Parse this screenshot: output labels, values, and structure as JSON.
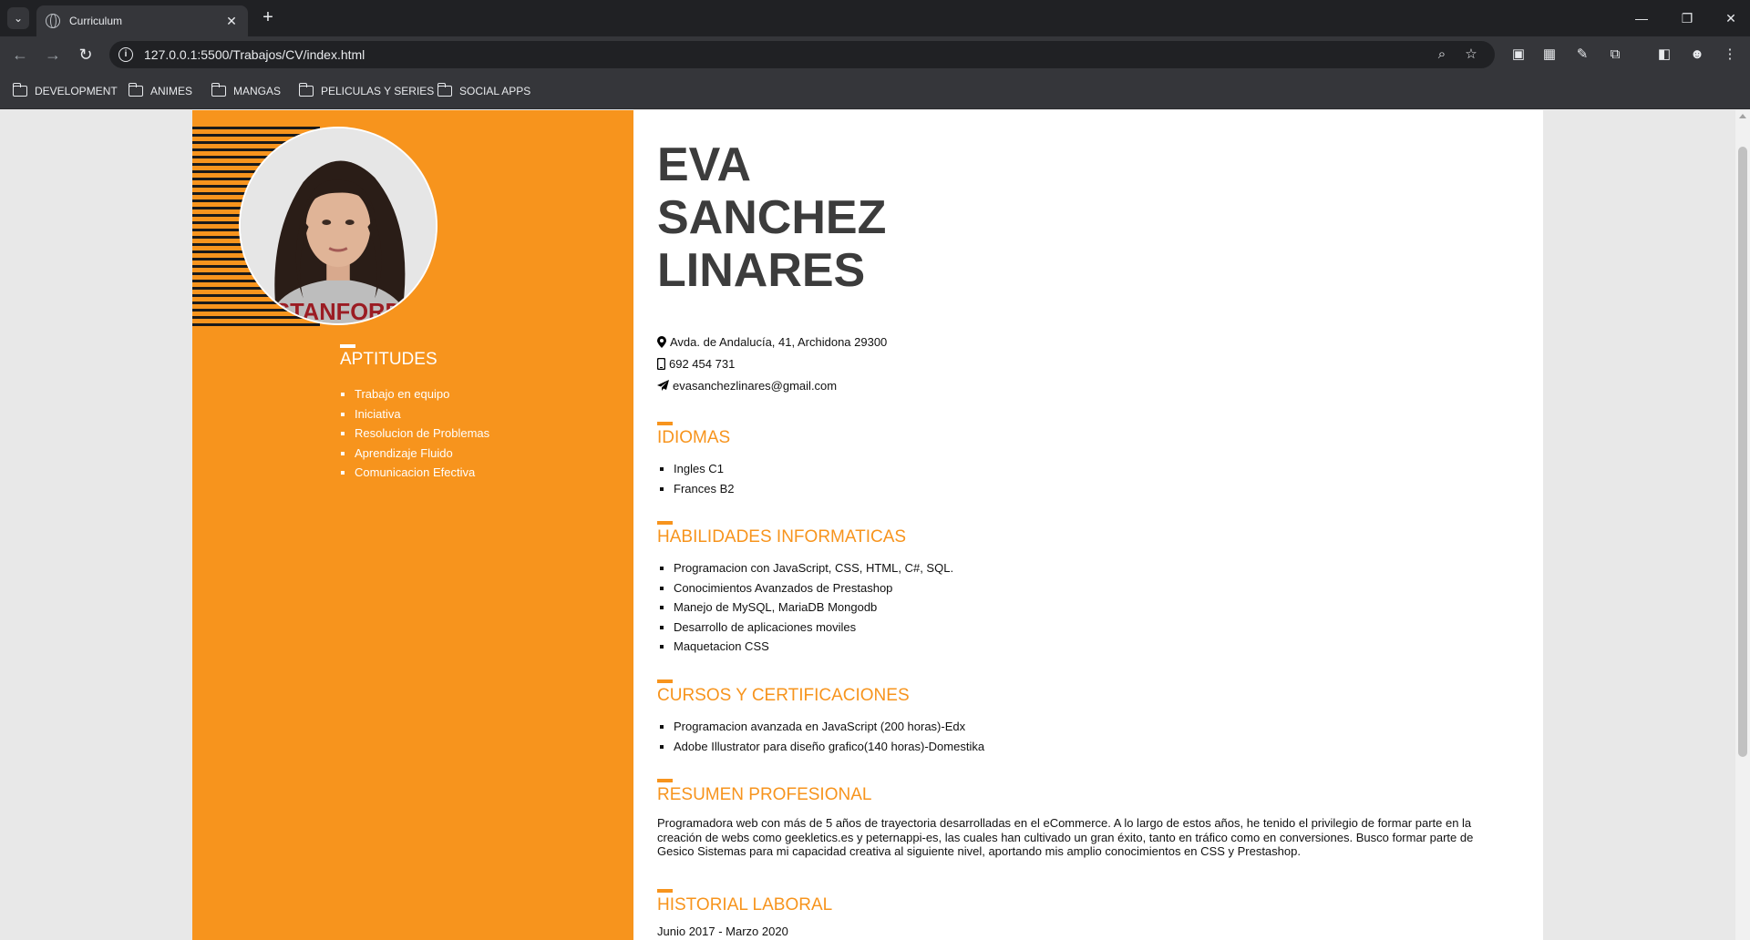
{
  "browser": {
    "tab_title": "Curriculum",
    "url": "127.0.0.1:5500/Trabajos/CV/index.html",
    "bookmarks": [
      "DEVELOPMENT",
      "ANIMES",
      "MANGAS",
      "PELICULAS Y SERIES",
      "SOCIAL APPS"
    ]
  },
  "cv": {
    "name_lines": [
      "EVA",
      "SANCHEZ",
      "LINARES"
    ],
    "contact": {
      "address": "Avda. de Andalucía, 41, Archidona 29300",
      "phone": "692 454 731",
      "email": "evasanchezlinares@gmail.com"
    },
    "aptitudes": {
      "title": "APTITUDES",
      "items": [
        "Trabajo en equipo",
        "Iniciativa",
        "Resolucion de Problemas",
        "Aprendizaje Fluido",
        "Comunicacion Efectiva"
      ]
    },
    "idiomas": {
      "title": "IDIOMAS",
      "items": [
        "Ingles C1",
        "Frances B2"
      ]
    },
    "habilidades": {
      "title": "HABILIDADES INFORMATICAS",
      "items": [
        "Programacion con JavaScript, CSS, HTML, C#, SQL.",
        "Conocimientos Avanzados de Prestashop",
        "Manejo de MySQL, MariaDB Mongodb",
        "Desarrollo de aplicaciones moviles",
        "Maquetacion CSS"
      ]
    },
    "cursos": {
      "title": "CURSOS Y CERTIFICACIONES",
      "items": [
        "Programacion avanzada en JavaScript (200 horas)-Edx",
        "Adobe Illustrator para diseño grafico(140 horas)-Domestika"
      ]
    },
    "resumen": {
      "title": "RESUMEN PROFESIONAL",
      "text": "Programadora web con más de 5 años de trayectoria desarrolladas en el eCommerce. A lo largo de estos años, he tenido el privilegio de formar parte en la creación de webs como geekletics.es y peternappi-es, las cuales han cultivado un gran éxito, tanto en tráfico como en conversiones. Busco formar parte de Gesico Sistemas para mi capacidad creativa al siguiente nivel, aportando mis amplio conocimientos en CSS y Prestashop."
    },
    "historial": {
      "title": "HISTORIAL LABORAL",
      "first_period": "Junio 2017 - Marzo 2020"
    }
  },
  "colors": {
    "accent": "#f7941d",
    "name_text": "#3c3c3c"
  }
}
